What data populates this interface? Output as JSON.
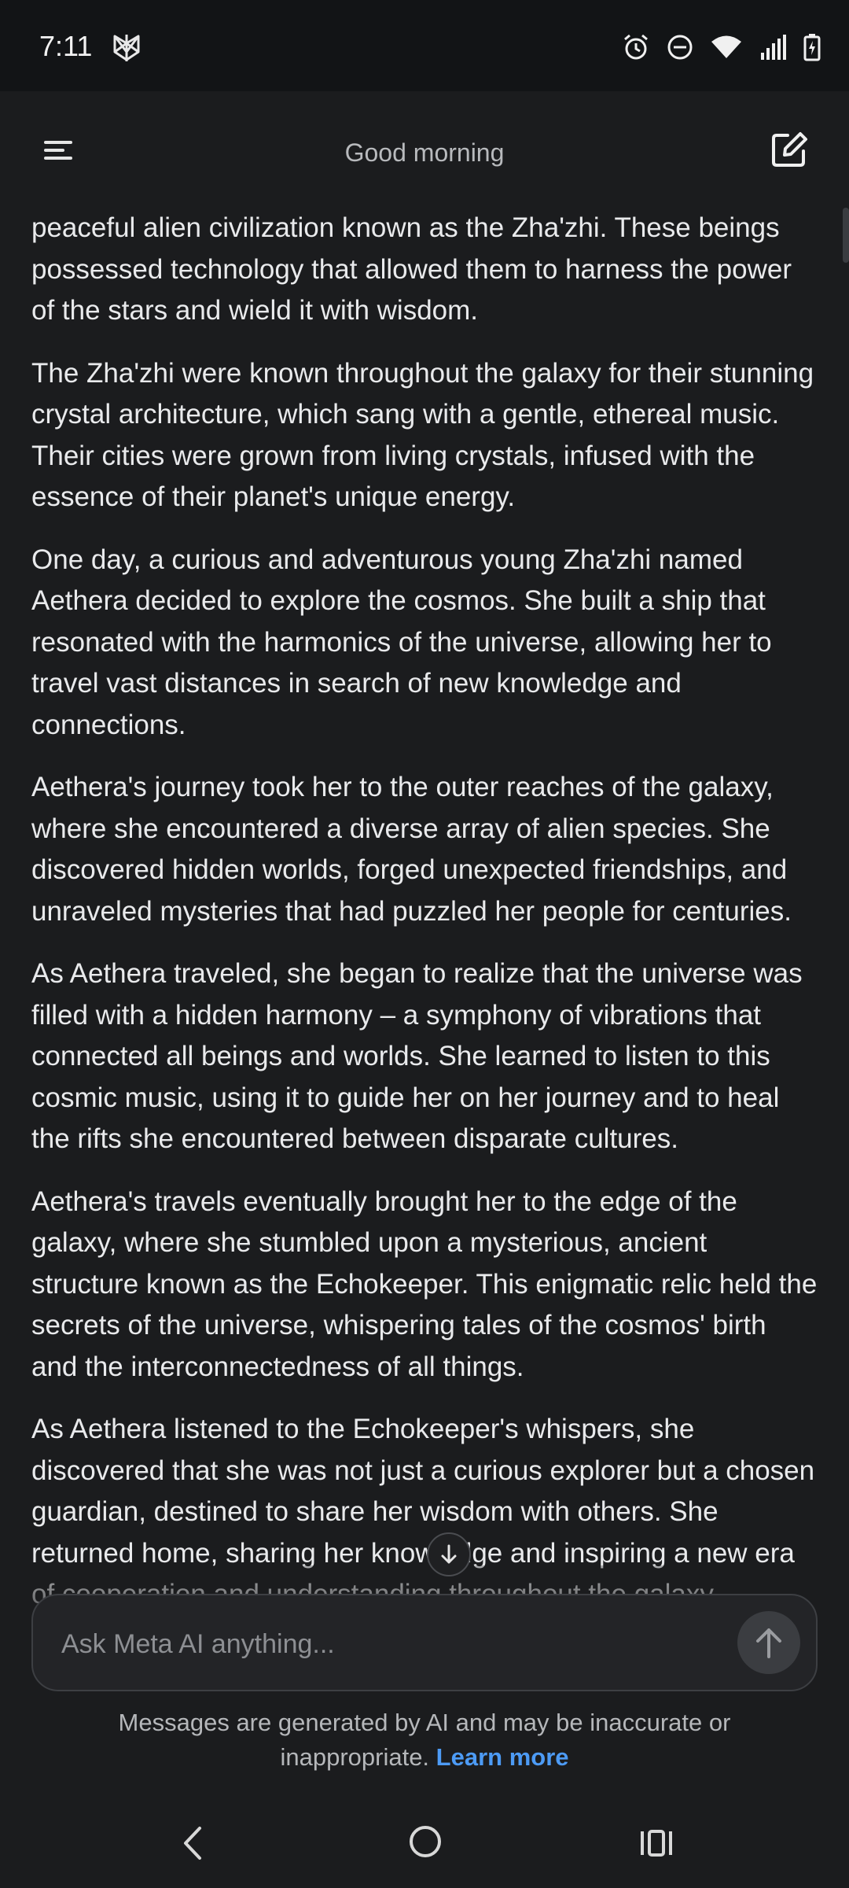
{
  "status_bar": {
    "time": "7:11",
    "app_icon": "perplexity-like-app-icon",
    "icons": [
      "alarm-icon",
      "do-not-disturb-icon",
      "wifi-icon",
      "signal-icon",
      "battery-charging-icon"
    ]
  },
  "header": {
    "title": "Good morning",
    "menu_icon": "menu-icon",
    "compose_icon": "new-chat-icon"
  },
  "messages": [
    "peaceful alien civilization known as the Zha'zhi. These beings possessed technology that allowed them to harness the power of the stars and wield it with wisdom.",
    "The Zha'zhi were known throughout the galaxy for their stunning crystal architecture, which sang with a gentle, ethereal music. Their cities were grown from living crystals, infused with the essence of their planet's unique energy.",
    "One day, a curious and adventurous young Zha'zhi named Aethera decided to explore the cosmos. She built a ship that resonated with the harmonics of the universe, allowing her to travel vast distances in search of new knowledge and connections.",
    "Aethera's journey took her to the outer reaches of the galaxy, where she encountered a diverse array of alien species. She discovered hidden worlds, forged unexpected friendships, and unraveled mysteries that had puzzled her people for centuries.",
    "As Aethera traveled, she began to realize that the universe was filled with a hidden harmony – a symphony of vibrations that connected all beings and worlds. She learned to listen to this cosmic music, using it to guide her on her journey and to heal the rifts she encountered between disparate cultures.",
    "Aethera's travels eventually brought her to the edge of the galaxy, where she stumbled upon a mysterious, ancient structure known as the Echokeeper. This enigmatic relic held the secrets of the universe, whispering tales of the cosmos' birth and the interconnectedness of all things.",
    "As Aethera listened to the Echokeeper's whispers, she discovered that she was not just a curious explorer but a chosen guardian, destined to share her wisdom with others. She returned home, sharing her knowledge and inspiring a new era of cooperation and understanding throughout the galaxy."
  ],
  "input": {
    "placeholder": "Ask Meta AI anything..."
  },
  "disclaimer": {
    "text": "Messages are generated by AI and may be inaccurate or inappropriate.",
    "link": "Learn more"
  },
  "colors": {
    "background": "#1b1c1e",
    "status_bar": "#121416",
    "link": "#4d9bf5"
  }
}
